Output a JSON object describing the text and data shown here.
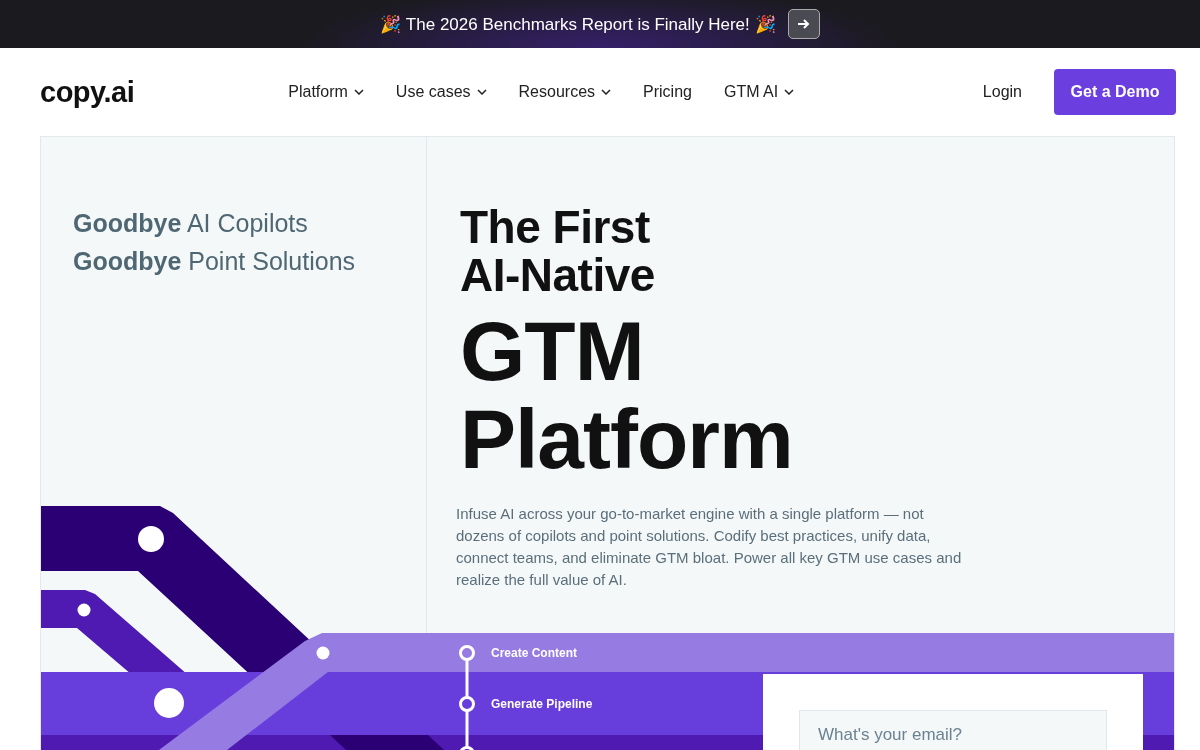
{
  "announcement": {
    "emoji_left": "🎉",
    "text": "The 2026 Benchmarks Report is Finally Here!",
    "emoji_right": "🎉"
  },
  "header": {
    "logo": "copy.ai",
    "nav": [
      {
        "label": "Platform",
        "has_menu": true
      },
      {
        "label": "Use cases",
        "has_menu": true
      },
      {
        "label": "Resources",
        "has_menu": true
      },
      {
        "label": "Pricing",
        "has_menu": false
      },
      {
        "label": "GTM AI",
        "has_menu": true
      }
    ],
    "login": "Login",
    "cta": "Get a Demo"
  },
  "hero": {
    "taglines": [
      "**Goodbye** AI Copilots",
      "**Goodbye** Point Solutions"
    ],
    "heading_small": [
      "The First",
      "AI-Native"
    ],
    "heading_large": [
      "GTM",
      "Platform"
    ],
    "description": "Infuse AI across your go-to-market engine with a single platform — not dozens of copilots and point solutions. Codify best practices, unify data, connect teams, and eliminate GTM bloat. Power all key GTM use cases and realize the full value of AI.",
    "steps": [
      "Create Content",
      "Generate Pipeline"
    ],
    "email": {
      "placeholder": "What's your email?"
    }
  }
}
